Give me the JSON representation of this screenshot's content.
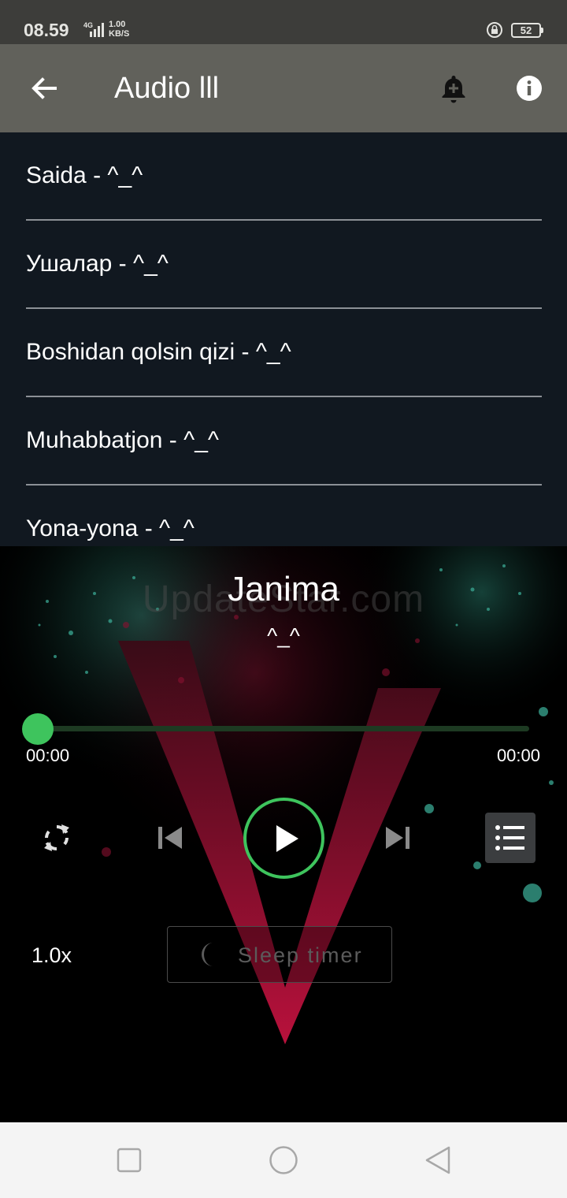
{
  "status_bar": {
    "time": "08.59",
    "network": "4G",
    "speed_value": "1.00",
    "speed_unit": "KB/S",
    "battery": "52"
  },
  "app_bar": {
    "title": "Audio lll",
    "icons": [
      "back-arrow-icon",
      "add-alarm-bell-icon",
      "info-icon"
    ]
  },
  "tracks": [
    {
      "label": "Saida - ^_^"
    },
    {
      "label": "Ушалар - ^_^"
    },
    {
      "label": "Boshidan qolsin qizi - ^_^"
    },
    {
      "label": "Muhabbatjon - ^_^"
    },
    {
      "label": "Yona-yona - ^_^"
    }
  ],
  "player": {
    "watermark": "UpdateStar.com",
    "title": "Janima",
    "artist": "^_^",
    "position": "00:00",
    "duration": "00:00",
    "progress": 0,
    "speed": "1.0x",
    "sleep_timer_label": "Sleep timer",
    "accent_color": "#3ec45d",
    "icons": [
      "repeat-icon",
      "previous-icon",
      "play-icon",
      "next-icon",
      "playlist-icon",
      "moon-icon"
    ]
  },
  "nav_bar": {
    "icons": [
      "recent-apps-icon",
      "home-icon",
      "back-icon"
    ]
  }
}
